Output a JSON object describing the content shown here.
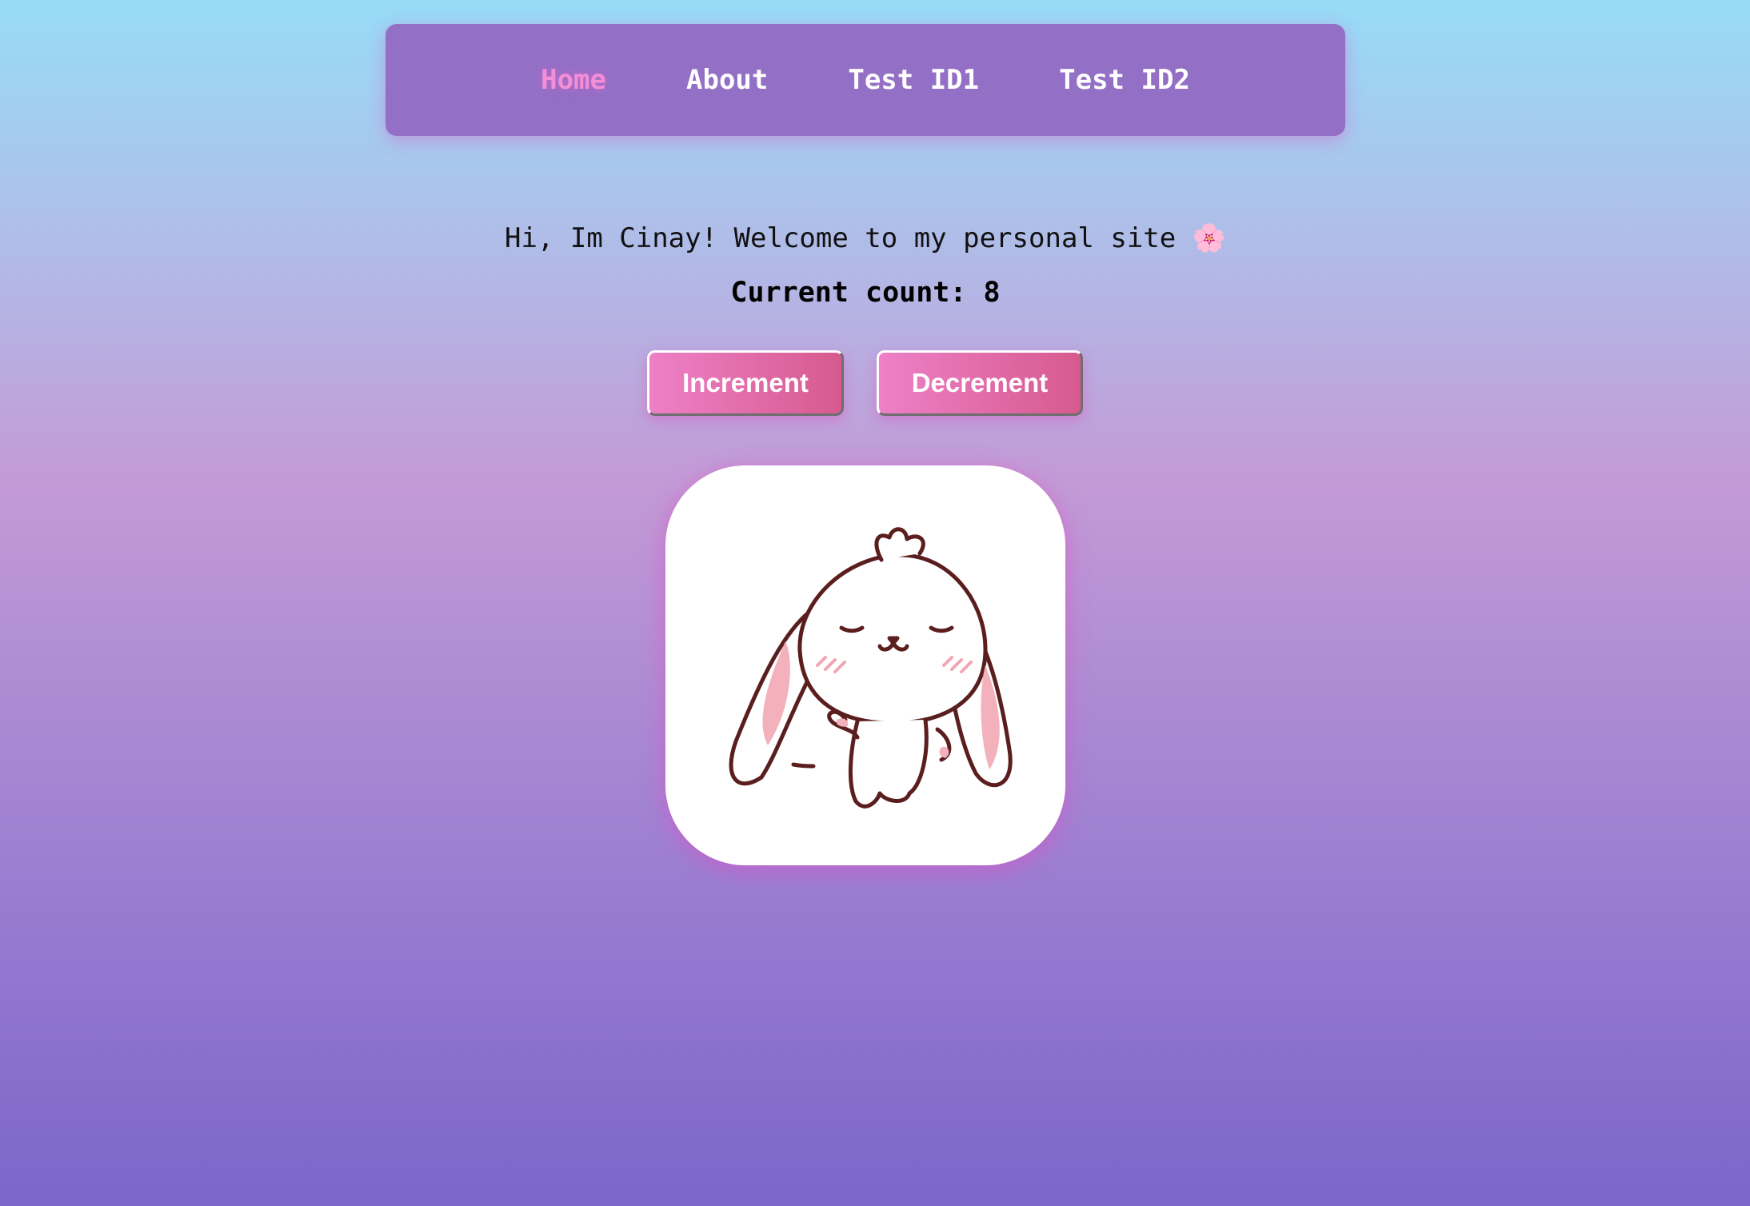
{
  "nav": {
    "items": [
      {
        "label": "Home",
        "active": true
      },
      {
        "label": "About",
        "active": false
      },
      {
        "label": "Test ID1",
        "active": false
      },
      {
        "label": "Test ID2",
        "active": false
      }
    ]
  },
  "main": {
    "welcome_text": "Hi, Im Cinay! Welcome to my personal site 🌸",
    "count_text": "Current count: 8",
    "increment_label": "Increment",
    "decrement_label": "Decrement",
    "image_icon": "bunny-illustration"
  },
  "colors": {
    "navbar": "#9370c6",
    "active_link": "#f28fd6",
    "button_gradient_start": "#ee80c7",
    "button_gradient_end": "#d65a8e"
  }
}
